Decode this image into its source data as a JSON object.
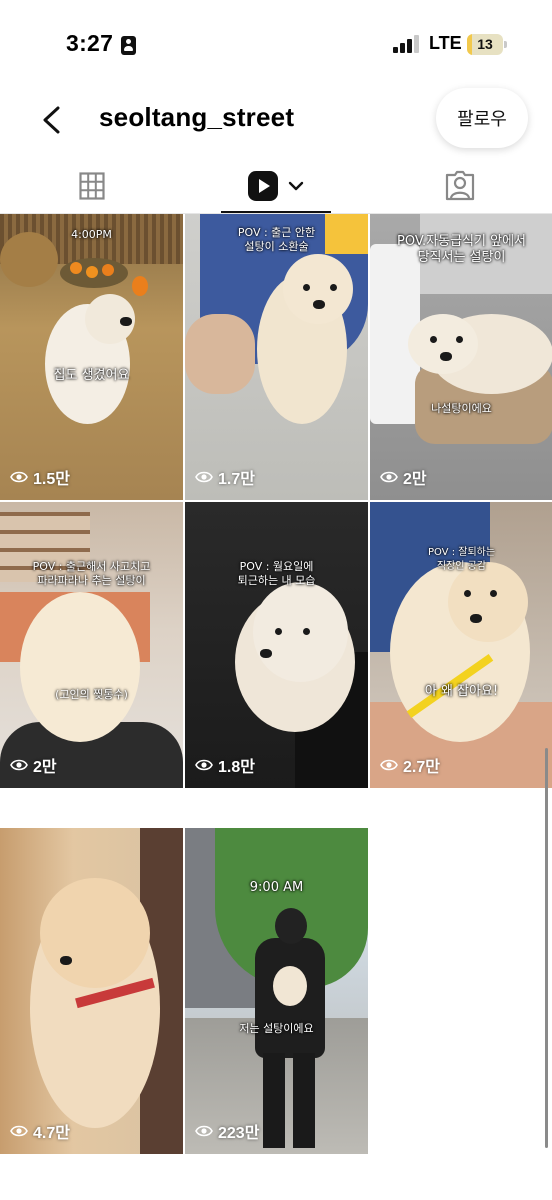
{
  "status_bar": {
    "time": "3:27",
    "network": "LTE",
    "battery": "13",
    "battery_level": 0.13
  },
  "header": {
    "username": "seoltang_street",
    "follow_label": "팔로우"
  },
  "tabs": [
    "grid-tab",
    "reels-tab",
    "tagged-tab"
  ],
  "reels": [
    {
      "caption": "4:00PM",
      "caption2": "집도 생겼어요",
      "views": "1.5만"
    },
    {
      "caption": "POV : 출근 안한\n설탕이 소환술",
      "views": "1.7만"
    },
    {
      "caption": "POV.자동급식기 앞에서\n당직서는 설탕이",
      "caption2": "나설탕이에요",
      "views": "2만"
    },
    {
      "caption": "POV : 출근해서 사고치고\n파라파라나 추는 설탕이",
      "caption2": "(고인의 찢통수)",
      "views": "2만"
    },
    {
      "caption": "POV : 월요일에\n퇴근하는 내 모습",
      "views": "1.8만"
    },
    {
      "caption": "POV : 잘퇴하는\n직장인 공감",
      "caption2": "아 왜 잡아요!",
      "views": "2.7만"
    },
    {
      "caption": "",
      "views": "4.7만"
    },
    {
      "caption": "9:00 AM",
      "caption2": "저는 설탕이에요",
      "views": "223만"
    }
  ],
  "colors": {
    "accent": "#111111",
    "follow_bg": "#ffffff",
    "battery": "#f2c94c"
  }
}
